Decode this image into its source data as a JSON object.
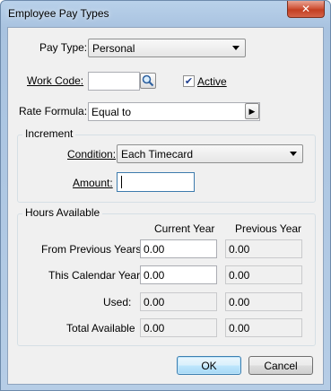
{
  "window": {
    "title": "Employee Pay Types",
    "close_glyph": "✕"
  },
  "pay_type": {
    "label": "Pay Type:",
    "value": "Personal"
  },
  "work_code": {
    "label": "Work Code:",
    "value": "",
    "lookup_icon": "magnifier-icon"
  },
  "active": {
    "label": "Active",
    "checked": true,
    "check_glyph": "✔"
  },
  "rate_formula": {
    "label": "Rate Formula:",
    "value": "Equal to",
    "arrow_glyph": "▶"
  },
  "increment": {
    "title": "Increment",
    "condition": {
      "label": "Condition:",
      "value": "Each Timecard"
    },
    "amount": {
      "label": "Amount:",
      "value": ""
    }
  },
  "hours_available": {
    "title": "Hours Available",
    "col_current": "Current Year",
    "col_previous": "Previous Year",
    "rows": [
      {
        "label": "From Previous Years:",
        "current": "0.00",
        "previous": "0.00"
      },
      {
        "label": "This Calendar Year:",
        "current": "0.00",
        "previous": "0.00"
      },
      {
        "label": "Used:",
        "current": "0.00",
        "previous": "0.00"
      },
      {
        "label": "Total Available",
        "current": "0.00",
        "previous": "0.00"
      }
    ]
  },
  "buttons": {
    "ok": "OK",
    "cancel": "Cancel"
  }
}
